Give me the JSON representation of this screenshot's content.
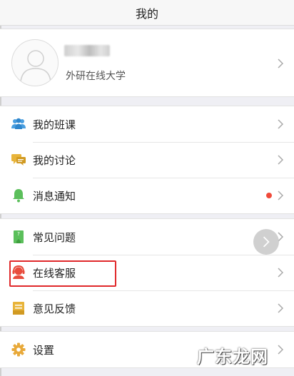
{
  "header": {
    "title": "我的"
  },
  "profile": {
    "name": "",
    "school": "外研在线大学"
  },
  "menu_groups": [
    {
      "items": [
        {
          "label": "我的班课",
          "icon": "people-icon",
          "color": "#4a9fe0"
        },
        {
          "label": "我的讨论",
          "icon": "chat-icon",
          "color": "#e8b43a"
        },
        {
          "label": "消息通知",
          "icon": "bell-icon",
          "color": "#5bbf5b",
          "has_badge": true
        }
      ]
    },
    {
      "items": [
        {
          "label": "常见问题",
          "icon": "faq-icon",
          "color": "#5bbf5b"
        },
        {
          "label": "在线客服",
          "icon": "customer-service-icon",
          "color": "#e84c3d"
        },
        {
          "label": "意见反馈",
          "icon": "feedback-icon",
          "color": "#e8b43a"
        }
      ]
    },
    {
      "items": [
        {
          "label": "设置",
          "icon": "gear-icon",
          "color": "#e8a93a"
        }
      ]
    }
  ],
  "colors": {
    "badge": "#f04a3a",
    "highlight": "#e0282a",
    "background": "#efeff4"
  },
  "watermark": "广东龙网"
}
